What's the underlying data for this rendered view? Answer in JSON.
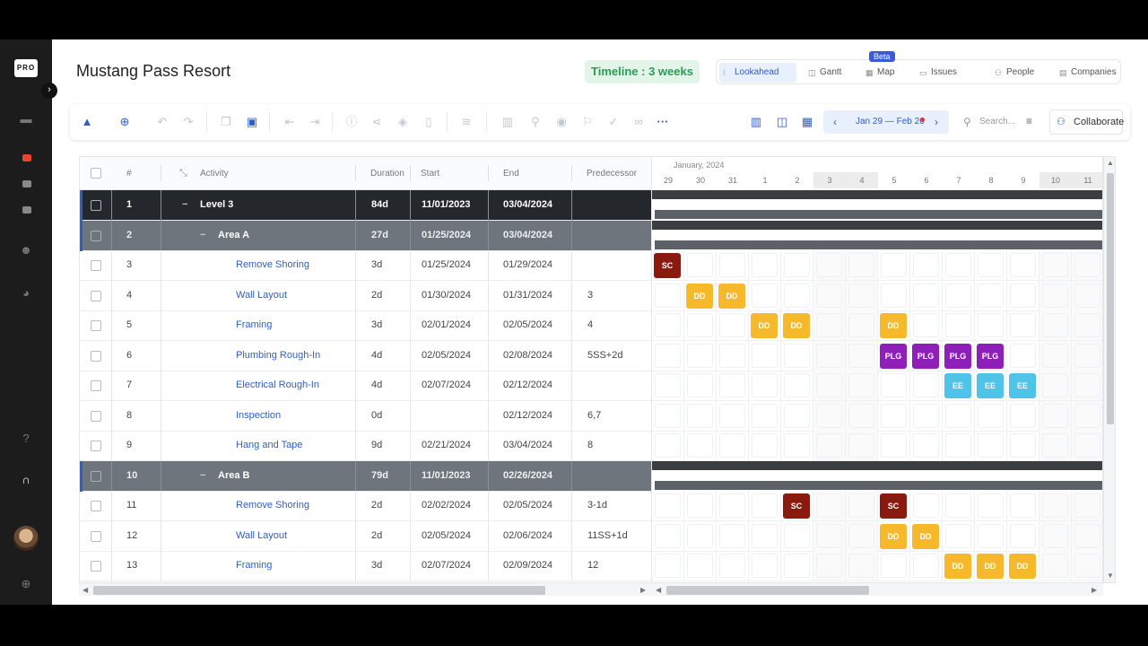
{
  "rail": {
    "logo": "PRO",
    "toggle": "›"
  },
  "header": {
    "title": "Mustang Pass Resort",
    "timeline_badge": "Timeline : 3 weeks",
    "beta": "Beta",
    "tabs": [
      {
        "label": "Lookahead",
        "icon": "lookahead-icon",
        "active": true
      },
      {
        "label": "Gantt",
        "icon": "gantt-icon"
      },
      {
        "label": "Map",
        "icon": "map-icon"
      },
      {
        "label": "Issues",
        "icon": "issues-icon"
      },
      {
        "label": "People",
        "icon": "people-icon"
      },
      {
        "label": "Companies",
        "icon": "companies-icon"
      }
    ]
  },
  "toolbar": {
    "date_range": "Jan 29 — Feb 26",
    "search_placeholder": "Search...",
    "collaborate": "Collaborate",
    "more": "···"
  },
  "grid": {
    "headers": {
      "num": "#",
      "activity": "Activity",
      "duration": "Duration",
      "start": "Start",
      "end": "End",
      "predecessor": "Predecessor"
    },
    "rows": [
      {
        "num": "1",
        "activity": "Level 3",
        "duration": "84d",
        "start": "11/01/2023",
        "end": "03/04/2024",
        "pred": "",
        "level": 1,
        "toggle": "−"
      },
      {
        "num": "2",
        "activity": "Area A",
        "duration": "27d",
        "start": "01/25/2024",
        "end": "03/04/2024",
        "pred": "",
        "level": 2,
        "toggle": "−"
      },
      {
        "num": "3",
        "activity": "Remove Shoring",
        "duration": "3d",
        "start": "01/25/2024",
        "end": "01/29/2024",
        "pred": "",
        "level": 3
      },
      {
        "num": "4",
        "activity": "Wall Layout",
        "duration": "2d",
        "start": "01/30/2024",
        "end": "01/31/2024",
        "pred": "3",
        "level": 3
      },
      {
        "num": "5",
        "activity": "Framing",
        "duration": "3d",
        "start": "02/01/2024",
        "end": "02/05/2024",
        "pred": "4",
        "level": 3
      },
      {
        "num": "6",
        "activity": "Plumbing Rough-In",
        "duration": "4d",
        "start": "02/05/2024",
        "end": "02/08/2024",
        "pred": "5SS+2d",
        "level": 3
      },
      {
        "num": "7",
        "activity": "Electrical Rough-In",
        "duration": "4d",
        "start": "02/07/2024",
        "end": "02/12/2024",
        "pred": "",
        "level": 3
      },
      {
        "num": "8",
        "activity": "Inspection",
        "duration": "0d",
        "start": "",
        "end": "02/12/2024",
        "pred": "6,7",
        "level": 3
      },
      {
        "num": "9",
        "activity": "Hang and Tape",
        "duration": "9d",
        "start": "02/21/2024",
        "end": "03/04/2024",
        "pred": "8",
        "level": 3
      },
      {
        "num": "10",
        "activity": "Area B",
        "duration": "79d",
        "start": "11/01/2023",
        "end": "02/26/2024",
        "pred": "",
        "level": 2,
        "toggle": "−"
      },
      {
        "num": "11",
        "activity": "Remove Shoring",
        "duration": "2d",
        "start": "02/02/2024",
        "end": "02/05/2024",
        "pred": "3-1d",
        "level": 3
      },
      {
        "num": "12",
        "activity": "Wall Layout",
        "duration": "2d",
        "start": "02/05/2024",
        "end": "02/06/2024",
        "pred": "11SS+1d",
        "level": 3
      },
      {
        "num": "13",
        "activity": "Framing",
        "duration": "3d",
        "start": "02/07/2024",
        "end": "02/09/2024",
        "pred": "12",
        "level": 3
      }
    ]
  },
  "gantt": {
    "month": "January, 2024",
    "days": [
      "29",
      "30",
      "31",
      "1",
      "2",
      "3",
      "4",
      "5",
      "6",
      "7",
      "8",
      "9",
      "10",
      "11"
    ],
    "weekend_days": [
      5,
      6,
      12,
      13
    ],
    "colors": {
      "SC": "#8b1a0e",
      "DD": "#f6b92c",
      "PLG": "#8e1fb8",
      "EE": "#4fc3e8",
      "summary": "#3a3d42",
      "summary2": "#5c6168"
    },
    "chips": [
      {
        "row": 2,
        "day": 0,
        "label": "SC"
      },
      {
        "row": 3,
        "day": 1,
        "label": "DD"
      },
      {
        "row": 3,
        "day": 2,
        "label": "DD"
      },
      {
        "row": 4,
        "day": 3,
        "label": "DD"
      },
      {
        "row": 4,
        "day": 4,
        "label": "DD"
      },
      {
        "row": 4,
        "day": 7,
        "label": "DD"
      },
      {
        "row": 5,
        "day": 7,
        "label": "PLG"
      },
      {
        "row": 5,
        "day": 8,
        "label": "PLG"
      },
      {
        "row": 5,
        "day": 9,
        "label": "PLG"
      },
      {
        "row": 5,
        "day": 10,
        "label": "PLG"
      },
      {
        "row": 6,
        "day": 9,
        "label": "EE"
      },
      {
        "row": 6,
        "day": 10,
        "label": "EE"
      },
      {
        "row": 6,
        "day": 11,
        "label": "EE"
      },
      {
        "row": 10,
        "day": 4,
        "label": "SC"
      },
      {
        "row": 10,
        "day": 7,
        "label": "SC"
      },
      {
        "row": 11,
        "day": 7,
        "label": "DD"
      },
      {
        "row": 11,
        "day": 8,
        "label": "DD"
      },
      {
        "row": 12,
        "day": 9,
        "label": "DD"
      },
      {
        "row": 12,
        "day": 10,
        "label": "DD"
      },
      {
        "row": 12,
        "day": 11,
        "label": "DD"
      }
    ]
  }
}
